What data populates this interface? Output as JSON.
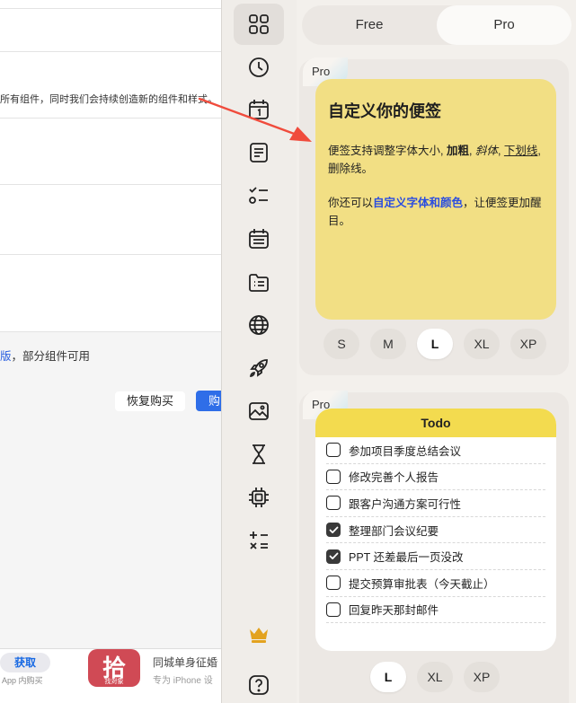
{
  "background_app": {
    "desc_text": "所有组件，同时我们会持续创造新的组件和样式。",
    "version_text_link": "版",
    "version_text_rest": "，部分组件可用",
    "restore_label": "恢复购买",
    "buy_label": "购",
    "get_label": "获取",
    "in_app_label": "App 内购买",
    "app_icon_glyph": "拾",
    "app_icon_caption": "找对象",
    "app_title": "同城单身征婚",
    "app_subtitle": "专为 iPhone 设"
  },
  "sidebar": {
    "items": [
      {
        "icon": "grid-icon",
        "active": true
      },
      {
        "icon": "clock-icon"
      },
      {
        "icon": "calendar-day-icon"
      },
      {
        "icon": "note-icon"
      },
      {
        "icon": "checklist-icon"
      },
      {
        "icon": "calendar-list-icon"
      },
      {
        "icon": "folder-list-icon"
      },
      {
        "icon": "globe-icon"
      },
      {
        "icon": "rocket-icon"
      },
      {
        "icon": "image-icon"
      },
      {
        "icon": "hourglass-icon"
      },
      {
        "icon": "chip-icon"
      },
      {
        "icon": "calculator-icon"
      }
    ],
    "crown_icon": "crown-icon",
    "help_icon": "help-icon"
  },
  "tabs": {
    "free": "Free",
    "pro": "Pro",
    "selected": "Pro"
  },
  "note_card": {
    "badge": "Pro",
    "title": "自定义你的便签",
    "line1_a": "便签支持调整字体大小, ",
    "line1_bold": "加粗",
    "line1_b": ", ",
    "line1_italic": "斜体",
    "line1_c": ", ",
    "line1_underline": "下划线",
    "line1_d": ",",
    "line1_strike": "删除线",
    "line1_e": "。",
    "line2_a": "你还可以",
    "line2_blue": "自定义字体和颜色",
    "line2_b": "，让便签更加醒目。",
    "sizes": [
      "S",
      "M",
      "L",
      "XL",
      "XP"
    ],
    "selected_size": "L",
    "colors": {
      "note": "#f2df84"
    }
  },
  "todo_card": {
    "badge": "Pro",
    "title": "Todo",
    "items": [
      {
        "text": "参加项目季度总结会议",
        "checked": false
      },
      {
        "text": "修改完善个人报告",
        "checked": false
      },
      {
        "text": "跟客户沟通方案可行性",
        "checked": false
      },
      {
        "text": "整理部门会议纪要",
        "checked": true
      },
      {
        "text": "PPT 还差最后一页没改",
        "checked": true
      },
      {
        "text": "提交预算审批表（今天截止）",
        "checked": false
      },
      {
        "text": "回复昨天那封邮件",
        "checked": false
      }
    ],
    "sizes": [
      "L",
      "XL",
      "XP"
    ],
    "selected_size": "L",
    "colors": {
      "header": "#f3db4f"
    }
  }
}
